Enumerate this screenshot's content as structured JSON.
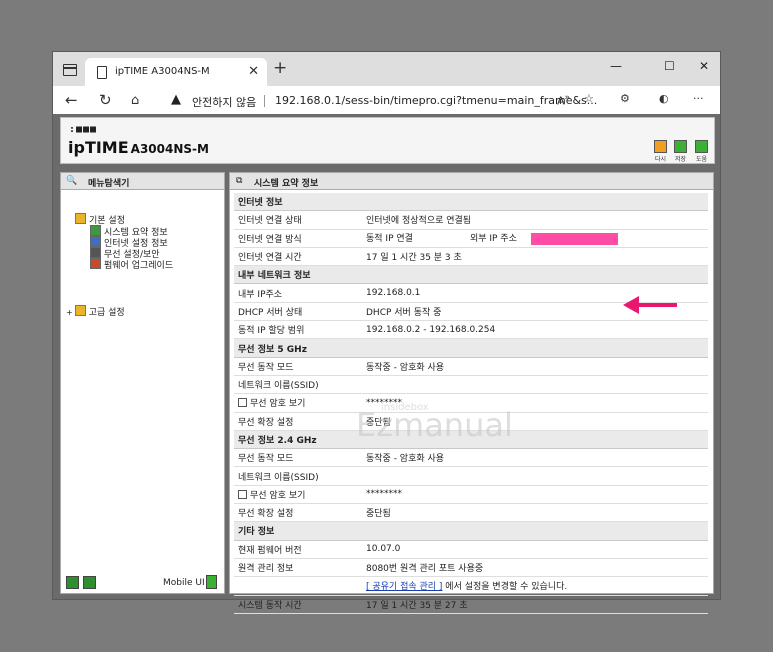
{
  "browser": {
    "tab_title": "ipTIME A3004NS-M",
    "security_label": "안전하지 않음",
    "url": "192.168.0.1/sess-bin/timepro.cgi?tmenu=main_frame&s..."
  },
  "router": {
    "logo_small": ":■■■",
    "logo": "ipTIME",
    "model": "A3004NS-M",
    "header_buttons": [
      {
        "label": "다시"
      },
      {
        "label": "저장"
      },
      {
        "label": "도움"
      }
    ]
  },
  "menu": {
    "title": "메뉴탐색기",
    "basic": "기본 설정",
    "items": [
      "시스템 요약 정보",
      "인터넷 설정 정보",
      "무선 설정/보안",
      "펌웨어 업그레이드"
    ],
    "advanced": "고급 설정",
    "mobile_ui": "Mobile UI"
  },
  "summary": {
    "title": "시스템 요약 정보",
    "internet_section": "인터넷 정보",
    "conn_status_label": "인터넷 연결 상태",
    "conn_status_value": "인터넷에 정상적으로 연결됨",
    "conn_method_label": "인터넷 연결 방식",
    "conn_method_value": "동적 IP 연결",
    "external_ip_label": "외부 IP 주소",
    "conn_time_label": "인터넷 연결 시간",
    "conn_time_value": "17 일 1 시간 35 분 3 초",
    "lan_section": "내부 네트워크 정보",
    "lan_ip_label": "내부 IP주소",
    "lan_ip_value": "192.168.0.1",
    "dhcp_label": "DHCP 서버 상태",
    "dhcp_value": "DHCP 서버 동작 중",
    "range_label": "동적 IP 할당 범위",
    "range_value": "192.168.0.2 -  192.168.0.254",
    "w5_section": "무선 정보 5 GHz",
    "w5_mode_label": "무선 동작 모드",
    "w5_mode_value": "동작중 - 암호화 사용",
    "w5_ssid_label": "네트워크 이름(SSID)",
    "w5_pw_label": "무선 암호 보기",
    "w5_pw_value": "********",
    "w5_ext_label": "무선 확장 설정",
    "w5_ext_value": "중단됨",
    "w24_section": "무선 정보 2.4 GHz",
    "w24_mode_label": "무선 동작 모드",
    "w24_mode_value": "동작중 - 암호화 사용",
    "w24_ssid_label": "네트워크 이름(SSID)",
    "w24_pw_label": "무선 암호 보기",
    "w24_pw_value": "********",
    "w24_ext_label": "무선 확장 설정",
    "w24_ext_value": "중단됨",
    "etc_section": "기타 정보",
    "fw_label": "현재 펌웨어 버전",
    "fw_value": "10.07.0",
    "remote_label": "원격 관리 정보",
    "remote_value": "8080번 원격 관리 포트 사용중",
    "remote_link": "[ 공유기 접속 관리 ]",
    "remote_note": " 에서 설정을 변경할 수 있습니다.",
    "uptime_label": "시스템 동작 시간",
    "uptime_value": "17 일 1 시간 35 분 27 초"
  },
  "watermark": {
    "line1": "insidebox",
    "line2": "Ezmanual"
  },
  "colors": {
    "redaction": "#ff4da6",
    "arrow": "#e8186e",
    "icon_orange": "#f0a020",
    "icon_green": "#3cb034"
  }
}
